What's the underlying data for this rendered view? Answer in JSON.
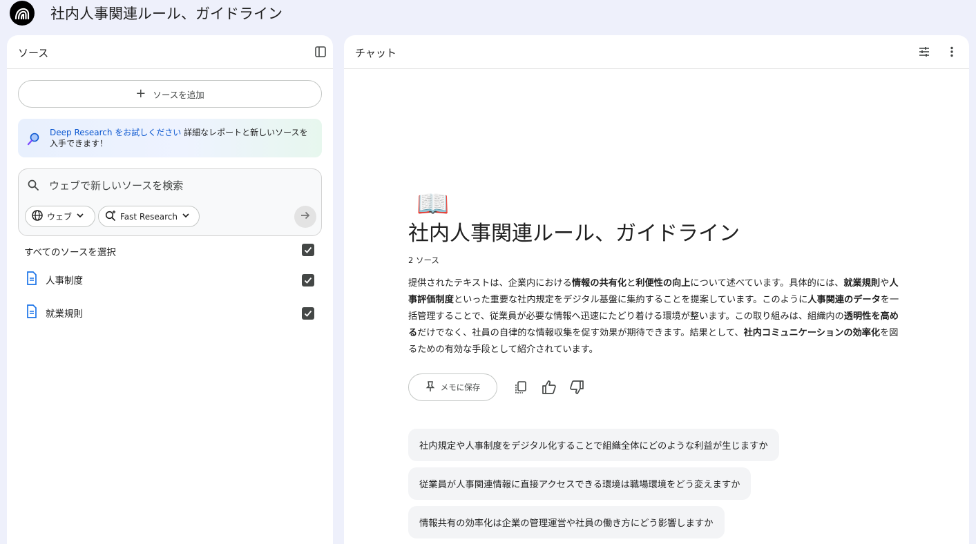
{
  "topbar": {
    "title": "社内人事関連ルール、ガイドライン"
  },
  "sources_panel": {
    "title": "ソース",
    "add_source_label": "ソースを追加",
    "promo": {
      "link_text": "Deep Research をお試しください",
      "text": " 詳細なレポートと新しいソースを入手できます！"
    },
    "search": {
      "placeholder": "ウェブで新しいソースを検索",
      "chip_web": "ウェブ",
      "chip_mode": "Fast Research"
    },
    "select_all_label": "すべてのソースを選択",
    "items": [
      {
        "name": "人事制度"
      },
      {
        "name": "就業規則"
      }
    ]
  },
  "chat_panel": {
    "title": "チャット",
    "emoji": "📖",
    "notebook_title": "社内人事関連ルール、ガイドライン",
    "source_count": "2 ソース",
    "summary_parts": [
      {
        "t": "提供されたテキストは、企業内における",
        "b": false
      },
      {
        "t": "情報の共有化",
        "b": true
      },
      {
        "t": "と",
        "b": false
      },
      {
        "t": "利便性の向上",
        "b": true
      },
      {
        "t": "について述べています。具体的には、",
        "b": false
      },
      {
        "t": "就業規則",
        "b": true
      },
      {
        "t": "や",
        "b": false
      },
      {
        "t": "人事評価制度",
        "b": true
      },
      {
        "t": "といった重要な社内規定をデジタル基盤に集約することを提案しています。このように",
        "b": false
      },
      {
        "t": "人事関連のデータ",
        "b": true
      },
      {
        "t": "を一括管理することで、従業員が必要な情報へ迅速にたどり着ける環境が整います。この取り組みは、組織内の",
        "b": false
      },
      {
        "t": "透明性を高める",
        "b": true
      },
      {
        "t": "だけでなく、社員の自律的な情報収集を促す効果が期待できます。結果として、",
        "b": false
      },
      {
        "t": "社内コミュニケーションの効率化",
        "b": true
      },
      {
        "t": "を図るための有効な手段として紹介されています。",
        "b": false
      }
    ],
    "save_note_label": "メモに保存",
    "suggestions": [
      "社内規定や人事制度をデジタル化することで組織全体にどのような利益が生じますか",
      "従業員が人事関連情報に直接アクセスできる環境は職場環境をどう変えますか",
      "情報共有の効率化は企業の管理運営や社員の働き方にどう影響しますか"
    ]
  }
}
